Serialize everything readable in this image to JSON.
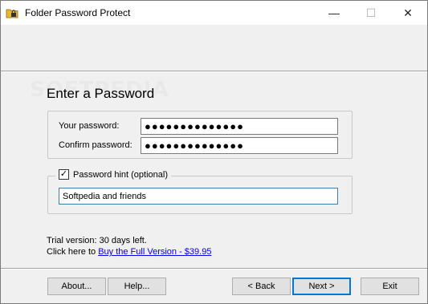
{
  "window": {
    "title": "Folder Password Protect",
    "controls": {
      "minimize": "—",
      "maximize": "☐",
      "close": "✕"
    }
  },
  "watermark": "SOFTPEDIA",
  "page_title": "Enter a Password",
  "password_group": {
    "password_label": "Your password:",
    "password_value": "●●●●●●●●●●●●●●",
    "confirm_label": "Confirm password:",
    "confirm_value": "●●●●●●●●●●●●●●"
  },
  "hint_group": {
    "checkbox_label": "Password hint (optional)",
    "checkbox_checked": "✓",
    "hint_value": "Softpedia and friends"
  },
  "trial": {
    "status_text": "Trial version: 30 days left.",
    "click_text": "Click here to ",
    "buy_link": "Buy the Full Version - $39.95"
  },
  "buttons": {
    "about": "About...",
    "help": "Help...",
    "back": "< Back",
    "next": "Next >",
    "exit": "Exit"
  },
  "colors": {
    "window_bg": "#f0f0f0",
    "link": "#0000ee",
    "default_button_border": "#0078d7"
  }
}
